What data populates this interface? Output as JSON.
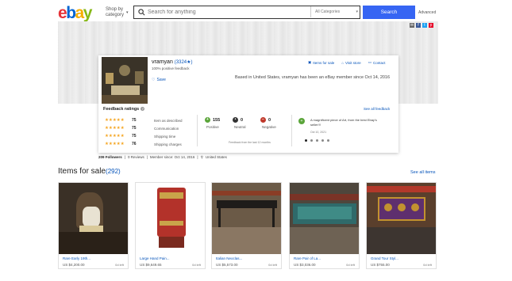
{
  "header": {
    "logo": [
      "e",
      "b",
      "a",
      "y"
    ],
    "shop_by": "Shop by",
    "category": "category",
    "search_placeholder": "Search for anything",
    "category_select": "All Categories",
    "search_button": "Search",
    "advanced": "Advanced"
  },
  "seller": {
    "username": "vramyan",
    "score": "(3324★)",
    "positive": "100% positive feedback",
    "save": "Save",
    "items_for_sale": "Items for sale",
    "visit_store": "Visit store",
    "contact": "Contact",
    "member_text": "Based in United States, vramyan has been an eBay member since Oct 14, 2016"
  },
  "feedback": {
    "title": "Feedback ratings",
    "see_all": "See all feedback",
    "ratings": [
      {
        "stars": "★★★★★",
        "value": "75",
        "label": "Item as described"
      },
      {
        "stars": "★★★★★",
        "value": "75",
        "label": "Communication"
      },
      {
        "stars": "★★★★★",
        "value": "75",
        "label": "Shipping time"
      },
      {
        "stars": "★★★★★",
        "value": "76",
        "label": "Shipping charges"
      }
    ],
    "positive": {
      "value": "155",
      "label": "Positive"
    },
    "neutral": {
      "value": "0",
      "label": "Neutral"
    },
    "negative": {
      "value": "0",
      "label": "Negative"
    },
    "months": "Feedback from the last 12 months",
    "comment": "A magnificent piece of Art, from the best Ebay's seller!!!",
    "comment_date": "Oct 10, 2021"
  },
  "stats": {
    "followers": "209 Followers",
    "reviews": "0 Reviews",
    "member_since": "Member since: Oct 14, 2016",
    "location": "United States"
  },
  "items": {
    "title": "Items for sale",
    "count": "(292)",
    "see_all": "See all items",
    "list": [
      {
        "title": "Rare Early 19th...",
        "price": "US $4,200.00",
        "sold": "0d left"
      },
      {
        "title": "Large Hand Pain...",
        "price": "US $9,649.65",
        "sold": "0d left"
      },
      {
        "title": "Italian Neoclas...",
        "price": "US $5,573.00",
        "sold": "0d left"
      },
      {
        "title": "Rare Pair of La...",
        "price": "US $3,036.00",
        "sold": "0d left"
      },
      {
        "title": "Grand Tour Styl...",
        "price": "US $755.00",
        "sold": "0d left"
      }
    ]
  },
  "colors": {
    "accent": "#3665f3",
    "link": "#0654ba",
    "star": "#f5a623",
    "positive": "#5ba53a"
  }
}
